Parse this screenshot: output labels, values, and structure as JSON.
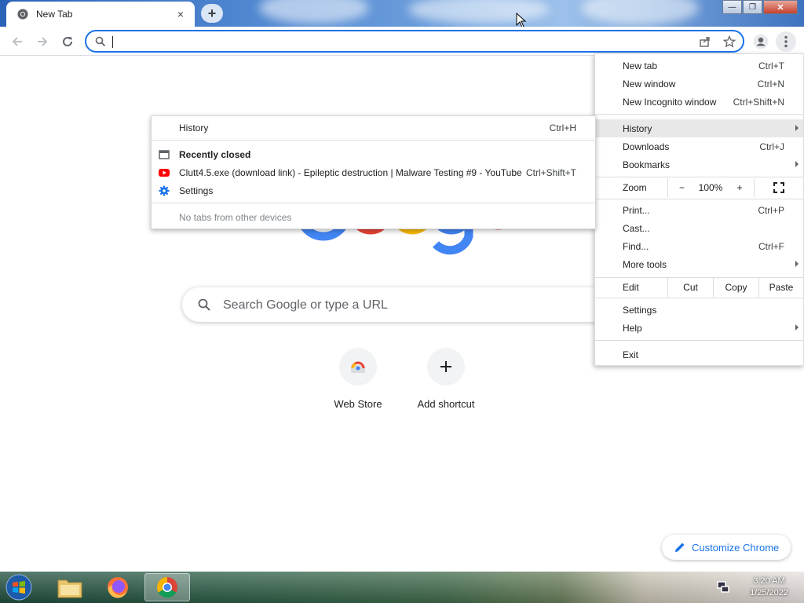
{
  "browser": {
    "tab_title": "New Tab",
    "tab_close": "×",
    "new_tab": "+",
    "window_controls": {
      "minimize": "—",
      "restore": "❐",
      "close": "✕"
    }
  },
  "page": {
    "search_placeholder": "Search Google or type a URL",
    "shortcuts": [
      {
        "label": "Web Store"
      },
      {
        "label": "Add shortcut"
      }
    ],
    "customize_label": "Customize Chrome"
  },
  "menu": {
    "new_tab": {
      "label": "New tab",
      "shortcut": "Ctrl+T"
    },
    "new_window": {
      "label": "New window",
      "shortcut": "Ctrl+N"
    },
    "incognito": {
      "label": "New Incognito window",
      "shortcut": "Ctrl+Shift+N"
    },
    "history": {
      "label": "History"
    },
    "downloads": {
      "label": "Downloads",
      "shortcut": "Ctrl+J"
    },
    "bookmarks": {
      "label": "Bookmarks"
    },
    "zoom": {
      "label": "Zoom",
      "minus": "−",
      "level": "100%",
      "plus": "+"
    },
    "print": {
      "label": "Print...",
      "shortcut": "Ctrl+P"
    },
    "cast": {
      "label": "Cast..."
    },
    "find": {
      "label": "Find...",
      "shortcut": "Ctrl+F"
    },
    "more_tools": {
      "label": "More tools"
    },
    "edit": {
      "label": "Edit",
      "cut": "Cut",
      "copy": "Copy",
      "paste": "Paste"
    },
    "settings": {
      "label": "Settings"
    },
    "help": {
      "label": "Help"
    },
    "exit": {
      "label": "Exit"
    }
  },
  "history_submenu": {
    "history": {
      "label": "History",
      "shortcut": "Ctrl+H"
    },
    "recently_closed": "Recently closed",
    "items": [
      {
        "label": "Clutt4.5.exe (download link) - Epileptic destruction | Malware Testing #9 - YouTube",
        "shortcut": "Ctrl+Shift+T"
      },
      {
        "label": "Settings",
        "shortcut": ""
      }
    ],
    "no_tabs": "No tabs from other devices"
  },
  "taskbar": {
    "time": "3:20 AM",
    "date": "1/25/2022"
  },
  "colors": {
    "accent": "#1a73e8",
    "youtube": "#ff0000"
  }
}
